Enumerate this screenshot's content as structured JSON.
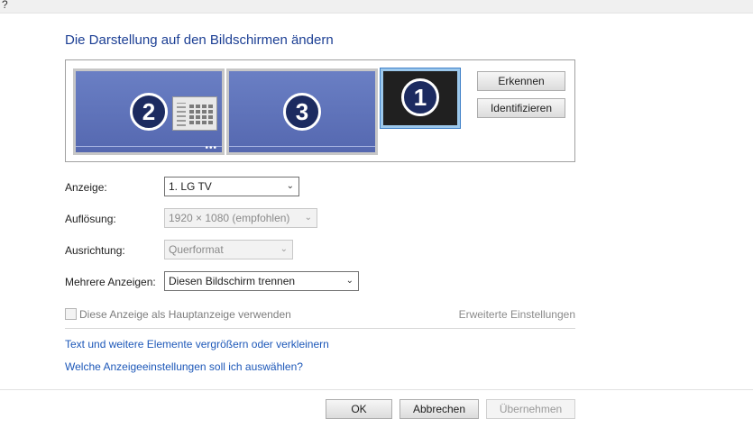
{
  "topbar": {
    "mark": "?"
  },
  "title": "Die Darstellung auf den Bildschirmen ändern",
  "monitors": [
    {
      "number": "2",
      "icons": [
        "keypad-icon"
      ],
      "dots": "•••"
    },
    {
      "number": "3"
    },
    {
      "number": "1",
      "selected": true
    }
  ],
  "buttons": {
    "detect": "Erkennen",
    "identify": "Identifizieren",
    "ok": "OK",
    "cancel": "Abbrechen",
    "apply": "Übernehmen"
  },
  "fields": {
    "display": {
      "label": "Anzeige:",
      "value": "1. LG TV"
    },
    "resolution": {
      "label": "Auflösung:",
      "value": "1920 × 1080 (empfohlen)"
    },
    "orientation": {
      "label": "Ausrichtung:",
      "value": "Querformat"
    },
    "multiple": {
      "label": "Mehrere Anzeigen:",
      "value": "Diesen Bildschirm trennen"
    }
  },
  "main_display_checkbox": "Diese Anzeige als Hauptanzeige verwenden",
  "advanced_link": "Erweiterte Einstellungen",
  "links": {
    "text_size": "Text und weitere Elemente vergrößern oder verkleinern",
    "which_settings": "Welche Anzeigeeinstellungen soll ich auswählen?"
  },
  "colors": {
    "title": "#1c3f94",
    "link": "#1c57b8",
    "monitor": "#5a6fb3",
    "selected_monitor": "#202020"
  }
}
